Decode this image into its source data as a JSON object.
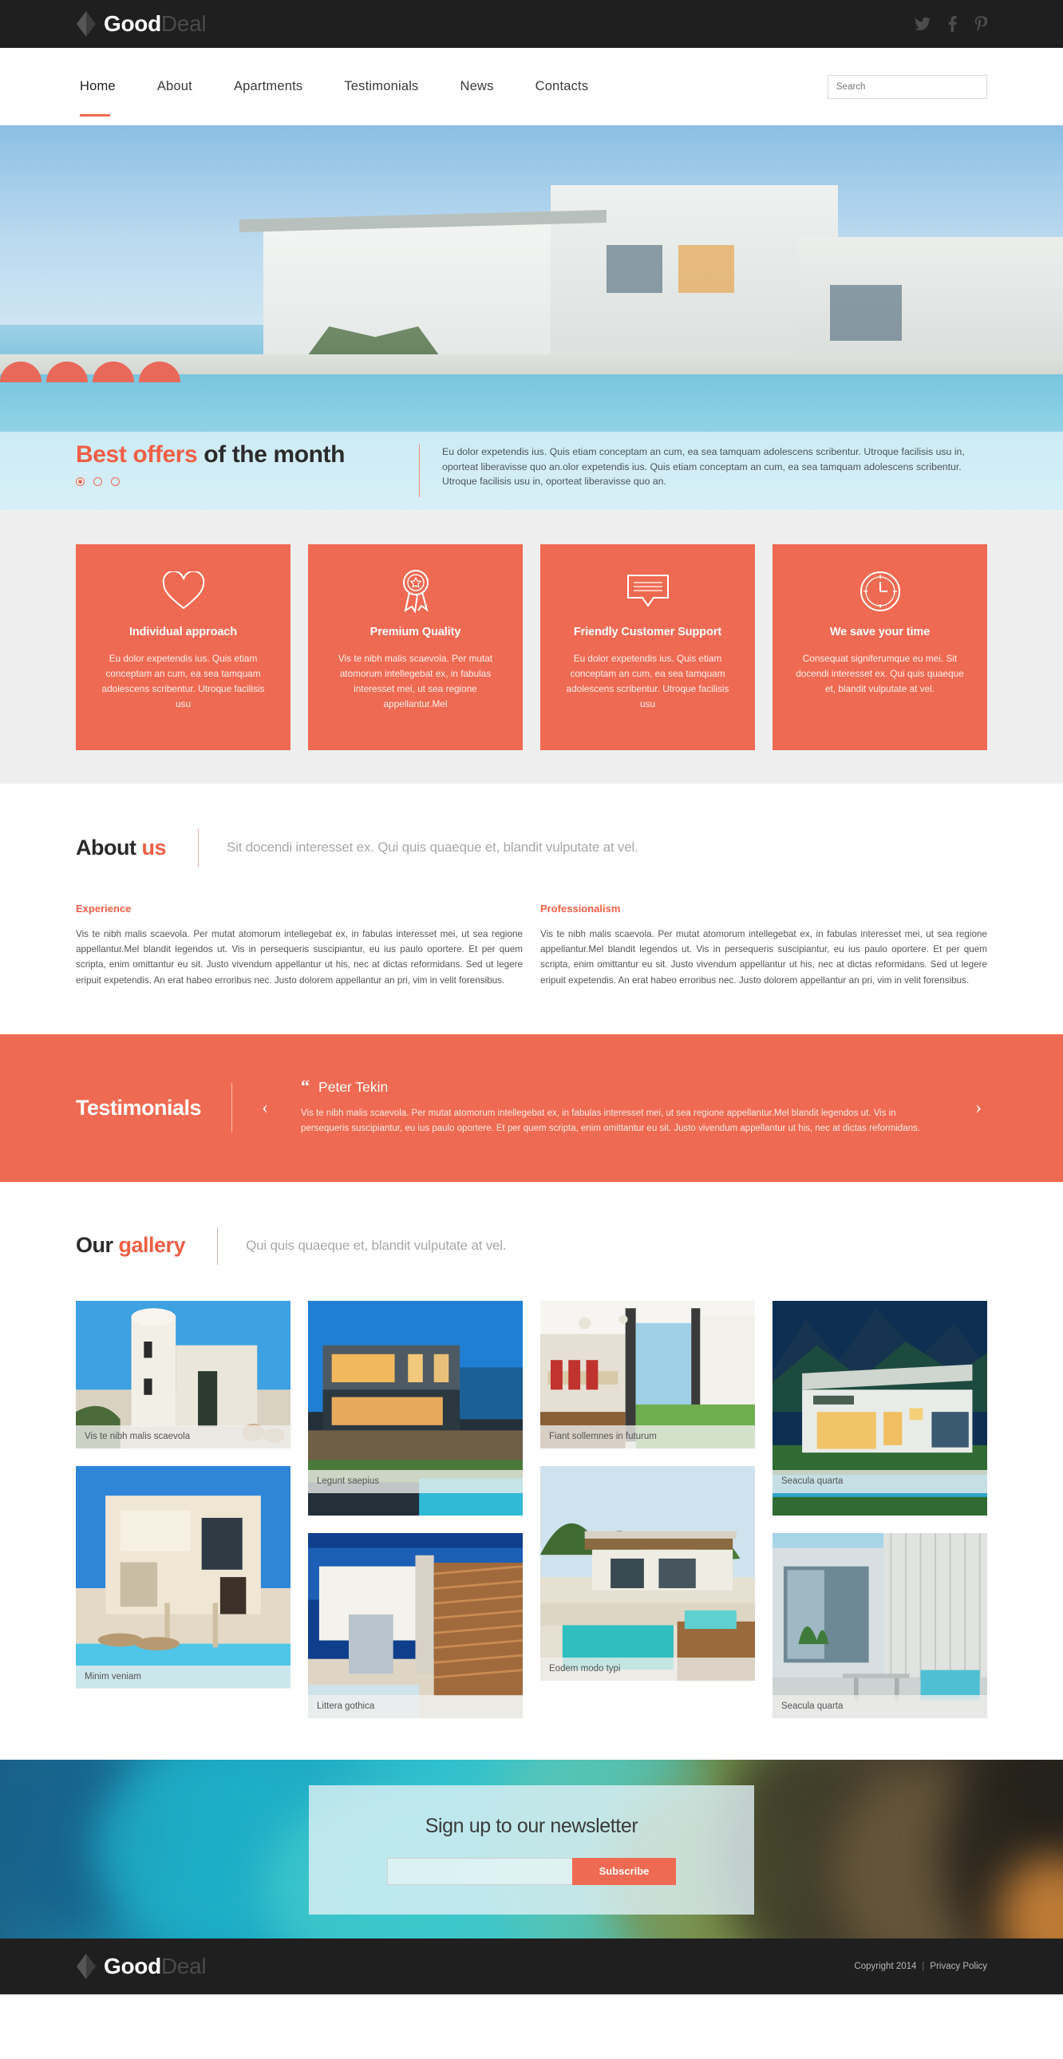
{
  "brand": {
    "name_bold": "Good",
    "name_light": "Deal",
    "logo_icon": "diamond-logo-icon"
  },
  "topbar": {
    "socials": [
      {
        "name": "twitter-icon",
        "label": "Twitter"
      },
      {
        "name": "facebook-icon",
        "label": "Facebook"
      },
      {
        "name": "pinterest-icon",
        "label": "Pinterest"
      }
    ]
  },
  "nav": {
    "items": [
      {
        "label": "Home",
        "active": true
      },
      {
        "label": "About",
        "active": false
      },
      {
        "label": "Apartments",
        "active": false
      },
      {
        "label": "Testimonials",
        "active": false
      },
      {
        "label": "News",
        "active": false
      },
      {
        "label": "Contacts",
        "active": false
      }
    ],
    "search": {
      "placeholder": "Search",
      "value": ""
    }
  },
  "hero": {
    "title_accent": "Best offers",
    "title_rest": "of the month",
    "description": "Eu dolor expetendis ius. Quis etiam conceptam an cum, ea sea tamquam adolescens scribentur. Utroque facilisis usu in, oporteat liberavisse quo an.olor expetendis ius. Quis etiam conceptam an cum, ea sea tamquam adolescens scribentur. Utroque facilisis usu in, oporteat liberavisse quo an.",
    "slides": 3,
    "active_slide": 1
  },
  "features": [
    {
      "icon": "heart-icon",
      "title": "Individual approach",
      "text": "Eu dolor expetendis ius. Quis etiam conceptam an cum, ea sea tamquam adolescens scribentur. Utroque facilisis usu"
    },
    {
      "icon": "award-ribbon-icon",
      "title": "Premium Quality",
      "text": "Vis te nibh malis scaevola. Per mutat atomorum intellegebat ex, in fabulas interesset mei, ut sea regione appellantur.Mel"
    },
    {
      "icon": "speech-bubble-icon",
      "title": "Friendly Customer Support",
      "text": "Eu dolor expetendis ius. Quis etiam conceptam an cum, ea sea tamquam adolescens scribentur. Utroque facilisis usu"
    },
    {
      "icon": "clock-icon",
      "title": "We save your time",
      "text": "Consequat signiferumque eu mei. Sit docendi interesset ex. Qui quis quaeque et, blandit vulputate at vel."
    }
  ],
  "about": {
    "title_dark": "About",
    "title_accent": "us",
    "subtitle": "Sit docendi interesset ex. Qui quis quaeque et, blandit vulputate at vel.",
    "columns": [
      {
        "heading": "Experience",
        "body": " Vis te nibh malis scaevola. Per mutat atomorum intellegebat ex, in fabulas interesset mei, ut sea regione appellantur.Mel blandit legendos ut. Vis in persequeris suscipiantur, eu ius paulo oportere. Et per quem scripta, enim omittantur eu sit. Justo vivendum appellantur ut his, nec at dictas reformidans. Sed ut legere eripuit expetendis. An erat habeo erroribus nec. Justo dolorem appellantur an pri, vim in velit forensibus."
      },
      {
        "heading": "Professionalism",
        "body": "Vis te nibh malis scaevola. Per mutat atomorum intellegebat ex, in fabulas interesset mei, ut sea regione appellantur.Mel blandit legendos ut. Vis in persequeris suscipiantur, eu ius paulo oportere. Et per quem scripta, enim omittantur eu sit. Justo vivendum appellantur ut his, nec at dictas reformidans. Sed ut legere eripuit expetendis. An erat habeo erroribus nec. Justo dolorem appellantur an pri, vim in velit forensibus."
      }
    ]
  },
  "testimonials": {
    "title": "Testimonials",
    "prev_icon": "chevron-left-icon",
    "next_icon": "chevron-right-icon",
    "quote_mark": "“",
    "author": "Peter Tekin",
    "text": "Vis te nibh malis scaevola. Per mutat atomorum intellegebat ex, in fabulas interesset mei, ut sea regione appellantur.Mel blandit legendos ut. Vis in persequeris suscipiantur, eu ius paulo oportere. Et per quem scripta, enim omittantur eu sit. Justo vivendum appellantur ut his, nec at dictas reformidans."
  },
  "gallery": {
    "title_dark": "Our",
    "title_accent": "gallery",
    "subtitle": "Qui quis quaeque et, blandit vulputate at vel.",
    "columns": [
      [
        {
          "caption": "Vis te nibh malis scaevola",
          "scene": "white-tower-villa"
        },
        {
          "caption": "Minim veniam",
          "scene": "poolside-villa"
        }
      ],
      [
        {
          "caption": "Legunt saepius",
          "scene": "night-modern-house"
        },
        {
          "caption": "Littera gothica",
          "scene": "louvered-facade"
        }
      ],
      [
        {
          "caption": "Fiant sollemnes in futurum",
          "scene": "dining-interior"
        },
        {
          "caption": "Eodem modo typi",
          "scene": "tropical-pool-house"
        }
      ],
      [
        {
          "caption": "Seacula quarta",
          "scene": "mountain-blue-house"
        },
        {
          "caption": "Seacula quarta",
          "scene": "glass-terrace-house"
        }
      ]
    ]
  },
  "newsletter": {
    "title": "Sign up to our newsletter",
    "input_value": "",
    "input_placeholder": "",
    "button_label": "Subscribe"
  },
  "footer": {
    "copyright": "Copyright 2014",
    "separator": "|",
    "privacy": "Privacy Policy"
  },
  "colors": {
    "accent": "#ef6a52",
    "accent_text": "#ef5f45",
    "dark": "#1f1f1f",
    "grey_bg": "#eeeeee"
  }
}
